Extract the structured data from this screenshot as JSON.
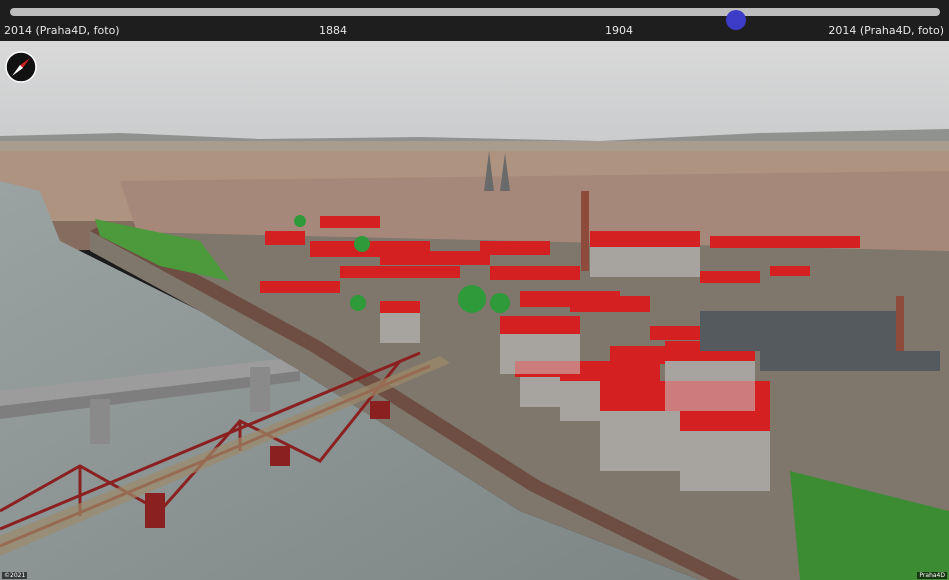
{
  "timeline": {
    "labels": [
      "2014 (Praha4D, foto)",
      "1884",
      "1904",
      "2014 (Praha4D, foto)"
    ],
    "slider_position": 0.771
  },
  "scene": {
    "icons": {
      "compass": "compass-icon"
    },
    "credits": {
      "left": "©2021",
      "right": "Praha4D"
    }
  },
  "colors": {
    "toolbar_bg": "#1e1e1e",
    "track": "#bdbdbd",
    "thumb": "#3c3cc8",
    "roof_red": "#d42020",
    "tree_green": "#2e9a3a",
    "river": "#8a9494"
  }
}
